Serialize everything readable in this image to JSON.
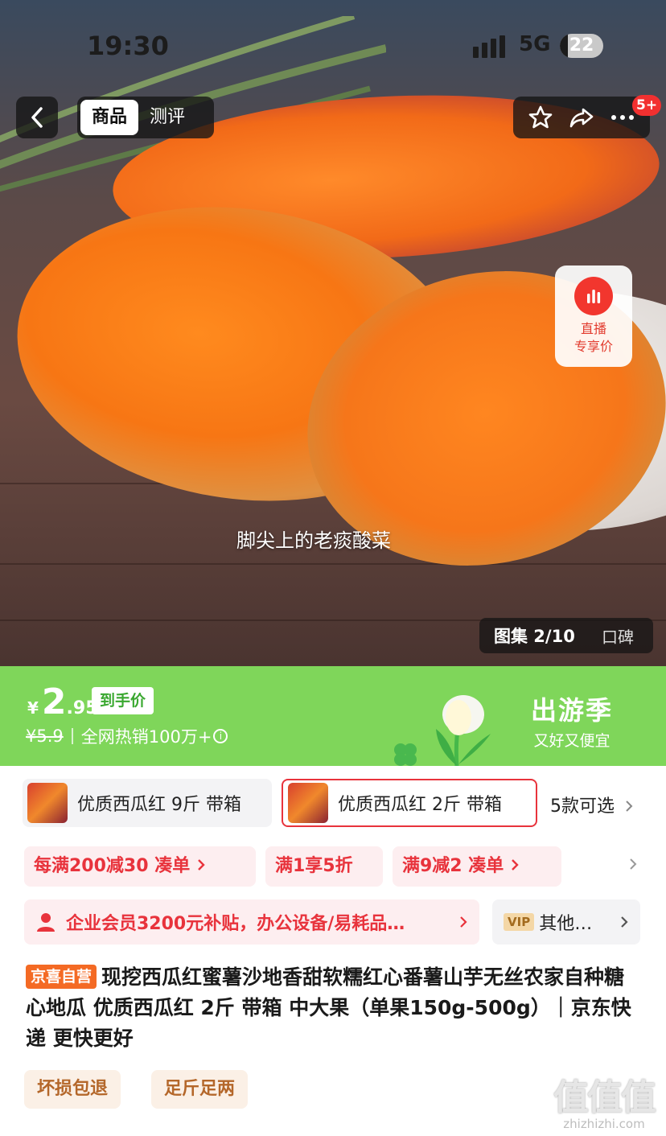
{
  "status_bar": {
    "time": "19:30",
    "network": "5G",
    "battery": "22"
  },
  "nav": {
    "tabs": [
      {
        "label": "商品",
        "active": true
      },
      {
        "label": "测评",
        "active": false
      }
    ],
    "badge": "5+"
  },
  "hero": {
    "live_label_1": "直播",
    "live_label_2": "专享价",
    "caption": "脚尖上的老痰酸菜",
    "gallery_label": "图集 2/10",
    "reviews_label": "口碑"
  },
  "price": {
    "currency": "¥",
    "integer": "2",
    "decimal": ".95",
    "final_tag": "到手价",
    "original": "¥5.9",
    "sales": "全网热销100万+",
    "season_title": "出游季",
    "season_sub": "又好又便宜"
  },
  "specs": {
    "items": [
      "优质西瓜红 9斤 带箱",
      "优质西瓜红 2斤 带箱"
    ],
    "more": "5款可选"
  },
  "coupons": [
    "每满200减30 凑单",
    "满1享5折",
    "满9减2 凑单"
  ],
  "member": {
    "text": "企业会员3200元补贴，办公设备/易耗品…",
    "vip_badge": "VIP",
    "vip_text": "其他…"
  },
  "title": {
    "tag": "京喜自营",
    "text": "现挖西瓜红蜜薯沙地香甜软糯红心番薯山芋无丝农家自种糖心地瓜 优质西瓜红 2斤 带箱 中大果（单果150g-500g）｜京东快递 更快更好"
  },
  "services": [
    "坏损包退",
    "足斤足两"
  ],
  "watermark": {
    "logo": "值值值",
    "site": "zhizhizhi.com"
  },
  "colors": {
    "price_band": "#7fd65a",
    "accent_red": "#e8333c",
    "self_tag": "#f46a24"
  }
}
